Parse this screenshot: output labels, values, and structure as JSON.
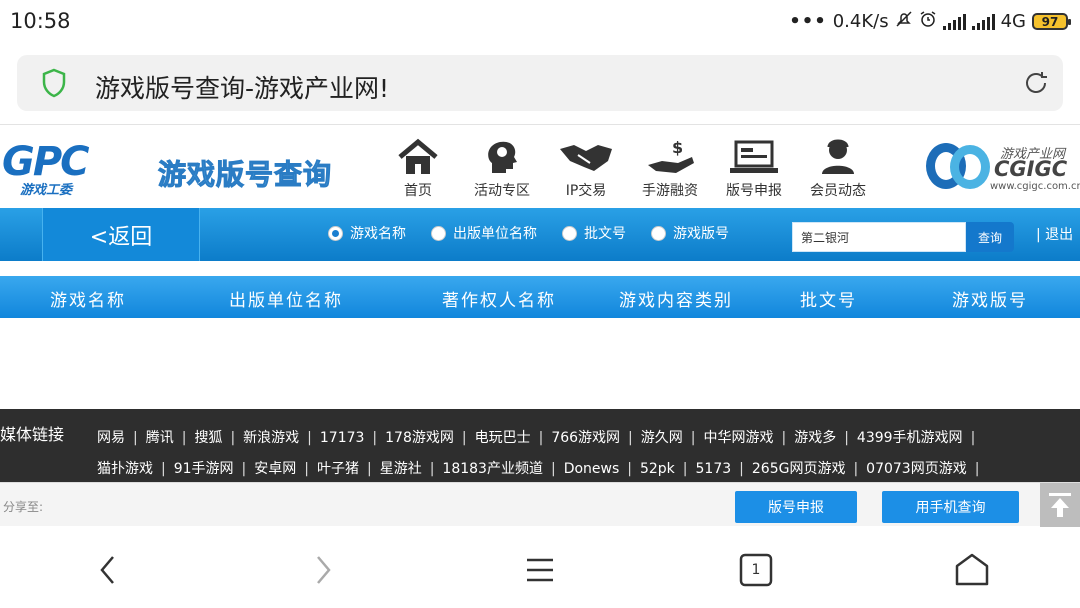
{
  "status_bar": {
    "time": "10:58",
    "dots": "•••",
    "speed": "0.4K/s",
    "network": "4G",
    "battery": "97"
  },
  "address_bar": {
    "title": "游戏版号查询-游戏产业网!"
  },
  "header": {
    "logo_text": "GPC",
    "logo_sub": "游戏工委",
    "site_title": "游戏版号查询",
    "nav": [
      {
        "label": "首页",
        "icon": "home-icon"
      },
      {
        "label": "活动专区",
        "icon": "head-bulb-icon"
      },
      {
        "label": "IP交易",
        "icon": "handshake-icon"
      },
      {
        "label": "手游融资",
        "icon": "money-hand-icon"
      },
      {
        "label": "版号申报",
        "icon": "laptop-icon"
      },
      {
        "label": "会员动态",
        "icon": "user-icon"
      }
    ],
    "partner_logo": {
      "line1": "游戏产业网",
      "line2": "CGIGC",
      "line3": "www.cgigc.com.cn"
    }
  },
  "search": {
    "back_label": "<返回",
    "options": [
      {
        "label": "游戏名称",
        "selected": true
      },
      {
        "label": "出版单位名称",
        "selected": false
      },
      {
        "label": "批文号",
        "selected": false
      },
      {
        "label": "游戏版号",
        "selected": false
      }
    ],
    "input_value": "第二银河",
    "button_label": "查询",
    "logout_label": "| 退出"
  },
  "table": {
    "columns": [
      "游戏名称",
      "出版单位名称",
      "著作权人名称",
      "游戏内容类别",
      "批文号",
      "游戏版号"
    ]
  },
  "media_links": {
    "label": "媒体链接",
    "row1": [
      "网易",
      "腾讯",
      "搜狐",
      "新浪游戏",
      "17173",
      "178游戏网",
      "电玩巴士",
      "766游戏网",
      "游久网",
      "中华网游戏",
      "游戏多",
      "4399手机游戏网"
    ],
    "row2": [
      "猫扑游戏",
      "91手游网",
      "安卓网",
      "叶子猪",
      "星游社",
      "18183产业频道",
      "Donews",
      "52pk",
      "5173",
      "265G网页游戏",
      "07073网页游戏"
    ]
  },
  "share": {
    "label": "分享至:",
    "apply_label": "版号申报",
    "mobile_label": "用手机查询"
  },
  "bottom_nav": {
    "tab_count": "1"
  }
}
